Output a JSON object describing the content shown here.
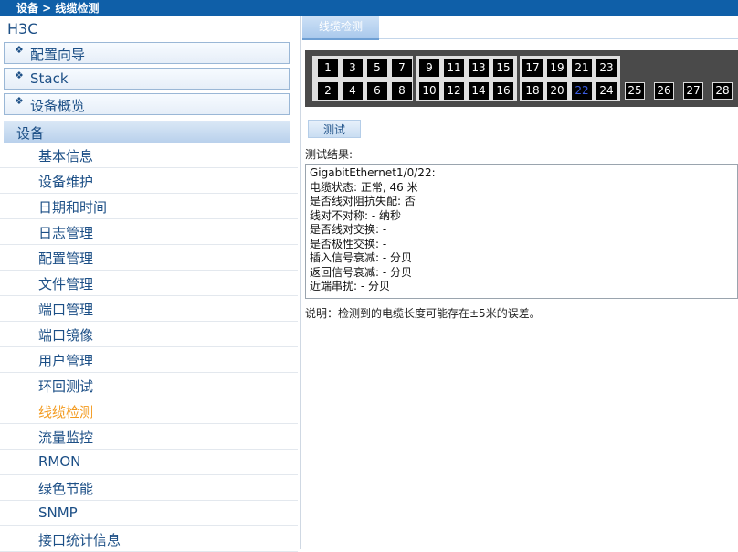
{
  "breadcrumb": "设备 > 线缆检测",
  "brand": "H3C",
  "nav_groups": [
    {
      "label": "配置向导"
    },
    {
      "label": "Stack"
    },
    {
      "label": "设备概览"
    }
  ],
  "active_section": "设备",
  "subitems": [
    "基本信息",
    "设备维护",
    "日期和时间",
    "日志管理",
    "配置管理",
    "文件管理",
    "端口管理",
    "端口镜像",
    "用户管理",
    "环回测试",
    "线缆检测",
    "流量监控",
    "RMON",
    "绿色节能",
    "SNMP",
    "接口统计信息"
  ],
  "current_subitem": "线缆检测",
  "tab_label": "线缆检测",
  "ports": {
    "g1": {
      "top": [
        "1",
        "3",
        "5",
        "7"
      ],
      "bottom": [
        "2",
        "4",
        "6",
        "8"
      ]
    },
    "g2": {
      "top": [
        "9",
        "11",
        "13",
        "15"
      ],
      "bottom": [
        "10",
        "12",
        "14",
        "16"
      ]
    },
    "g3": {
      "top": [
        "17",
        "19",
        "21",
        "23"
      ],
      "bottom": [
        "18",
        "20",
        "22",
        "24"
      ]
    },
    "sfp": [
      "25",
      "26",
      "27",
      "28"
    ],
    "selected": "22"
  },
  "test_button": "测试",
  "result_label": "测试结果:",
  "result_lines": [
    "GigabitEthernet1/0/22:",
    "电缆状态: 正常, 46 米",
    "是否线对阻抗失配: 否",
    "线对不对称: - 纳秒",
    "是否线对交换: -",
    "是否极性交换: -",
    "插入信号衰减: - 分贝",
    "返回信号衰减: - 分贝",
    "近端串扰: - 分贝"
  ],
  "note": "说明：检测到的电缆长度可能存在±5米的误差。"
}
